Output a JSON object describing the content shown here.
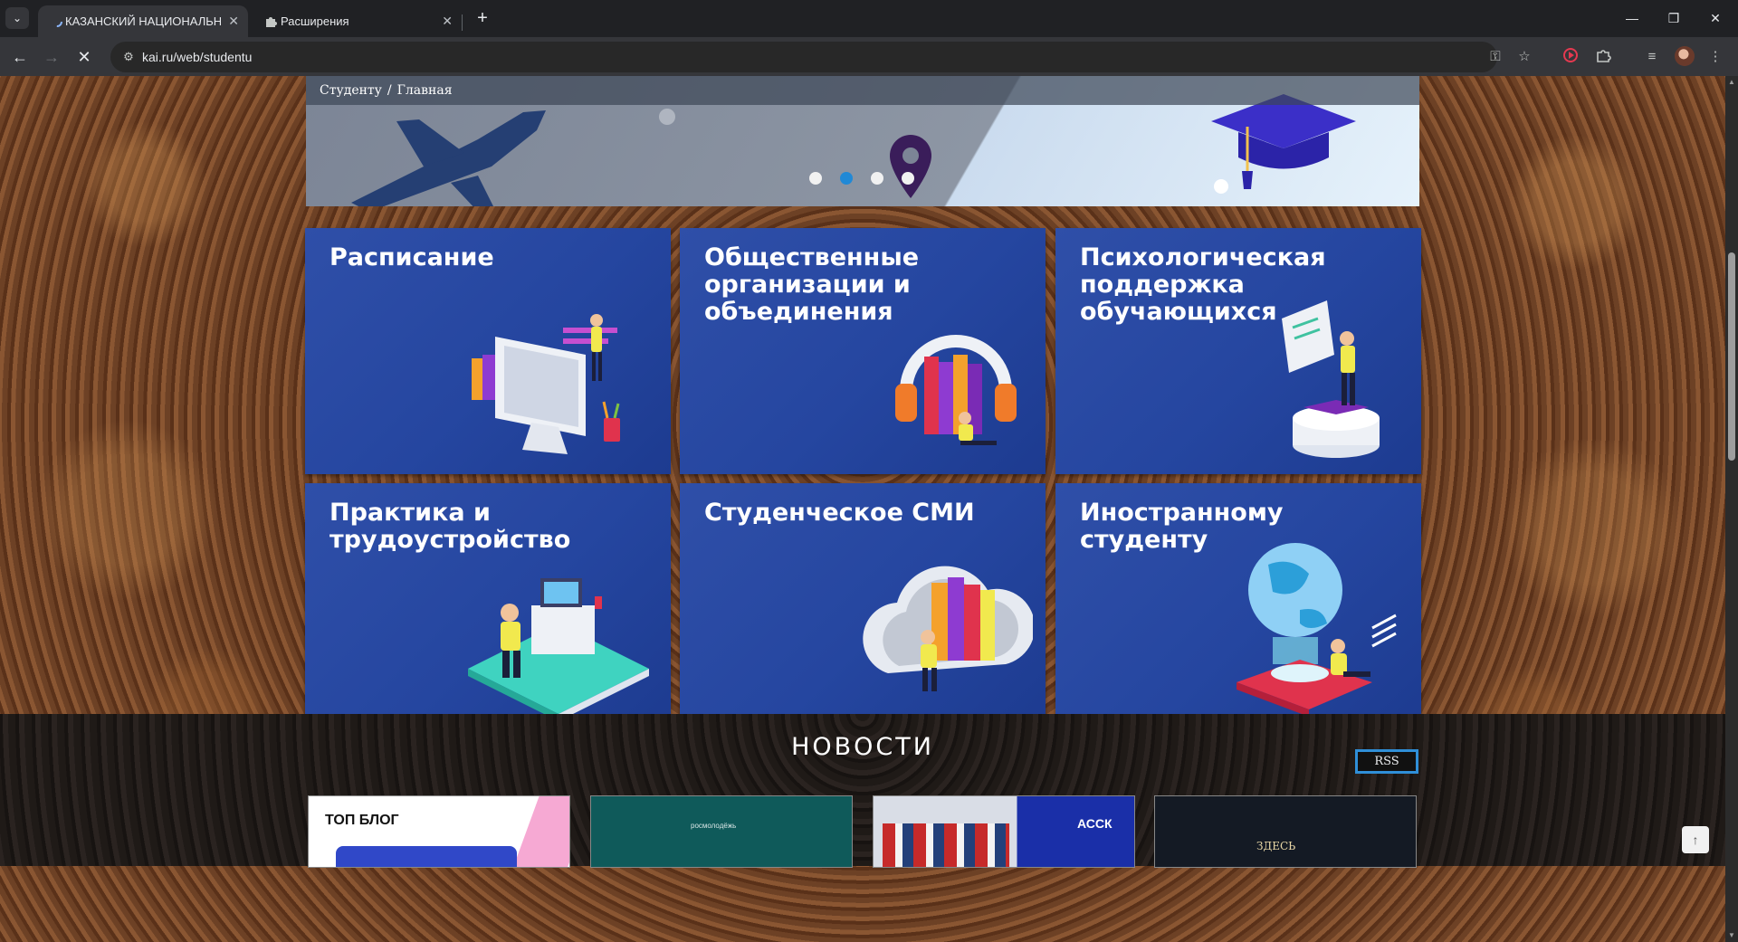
{
  "browser": {
    "tabs": [
      {
        "title": "КАЗАНСКИЙ НАЦИОНАЛЬНЫЙ",
        "active": true
      },
      {
        "title": "Расширения",
        "active": false
      }
    ],
    "url": "kai.ru/web/studentu",
    "tab_close_symbol": "✕",
    "new_tab_symbol": "+"
  },
  "breadcrumb": {
    "root": "Студенту",
    "separator": "/",
    "current": "Главная"
  },
  "carousel": {
    "slide_count": 4,
    "active_index": 1
  },
  "tiles": [
    {
      "title": "Расписание",
      "illustration": "computer-screen-person"
    },
    {
      "title": "Общественные организации и объединения",
      "illustration": "headphones-books"
    },
    {
      "title": "Психологическая поддержка обучающихся",
      "illustration": "book-podium-person"
    },
    {
      "title": "Практика и трудоустройство",
      "illustration": "desk-laptop-person"
    },
    {
      "title": "Студенческое СМИ",
      "illustration": "cloud-books"
    },
    {
      "title": "Иностранному студенту",
      "illustration": "globe-book"
    }
  ],
  "news": {
    "heading": "НОВОСТИ",
    "rss_label": "RSS",
    "cards": [
      {
        "label": "ТОП БЛОГ"
      },
      {
        "label": "росмолодёжь"
      },
      {
        "label": "АССК"
      },
      {
        "label": "ЗДЕСЬ"
      }
    ]
  },
  "colors": {
    "tile_blue": "#2546a0",
    "carousel_active_dot": "#2189d6",
    "rss_border": "#2f8fd8"
  }
}
